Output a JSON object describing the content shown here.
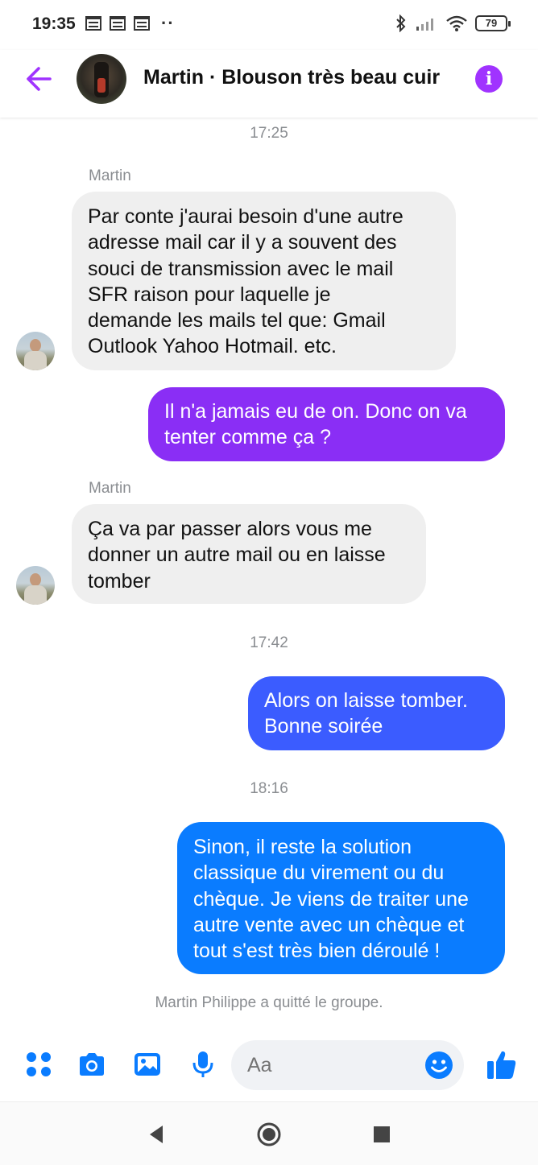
{
  "status_bar": {
    "time": "19:35",
    "battery": "79"
  },
  "header": {
    "title": "Martin · Blouson très beau cuir"
  },
  "messages": {
    "t1": "17:25",
    "sender1": "Martin",
    "m1_lines": [
      "Par conte j'aurai besoin d'une autre",
      "adresse mail car il y a souvent des",
      "souci de transmission avec le mail",
      "SFR raison pour laquelle je",
      "demande les mails tel que: Gmail",
      "Outlook Yahoo Hotmail. etc."
    ],
    "m2_lines": [
      "Il n'a jamais eu de on. Donc on va",
      "tenter comme ça ?"
    ],
    "sender2": "Martin",
    "m3_lines": [
      "Ça va par passer alors vous me",
      "donner un autre mail ou en laisse",
      "tomber"
    ],
    "t2": "17:42",
    "m4_lines": [
      "Alors on laisse tomber.",
      "Bonne soirée"
    ],
    "t3": "18:16",
    "m5_lines": [
      "Sinon, il reste la solution",
      "classique du virement ou du",
      "chèque. Je viens de traiter une",
      "autre vente avec un chèque et",
      "tout s'est très bien déroulé !"
    ],
    "system_note": "Martin Philippe a quitté le groupe."
  },
  "composer": {
    "placeholder": "Aa"
  },
  "colors": {
    "accent": "#a033ff",
    "icon_blue": "#0a7cff",
    "bubble_incoming": "#efefef",
    "bubble_out_1": "#8a2ef5",
    "bubble_out_2": "#3b5cff",
    "bubble_out_3": "#0a7cff"
  },
  "icons": [
    "back-arrow-icon",
    "info-icon",
    "apps-icon",
    "camera-icon",
    "gallery-icon",
    "microphone-icon",
    "emoji-icon",
    "thumbs-up-icon",
    "nav-back-icon",
    "nav-home-icon",
    "nav-recents-icon"
  ]
}
